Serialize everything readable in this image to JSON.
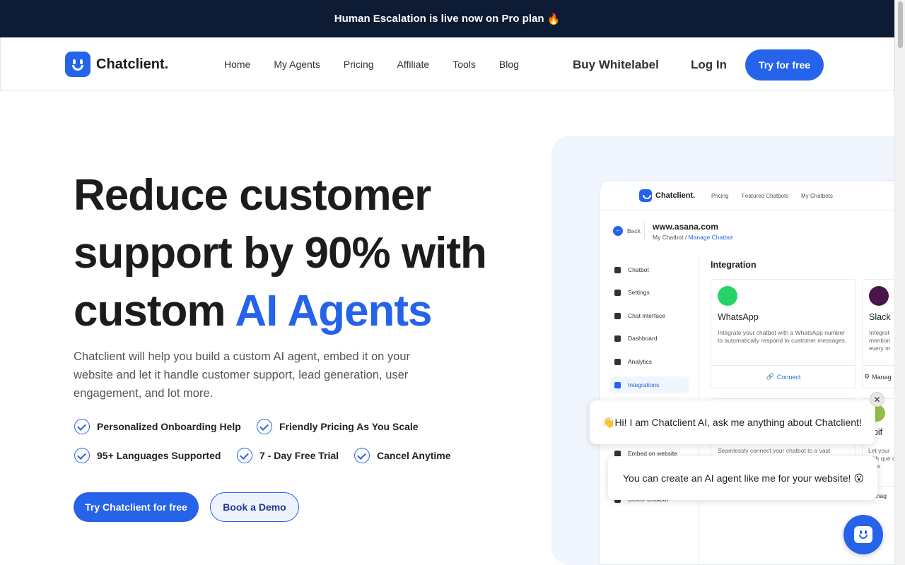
{
  "banner": {
    "text": "Human Escalation is live now on Pro plan",
    "emoji": "🔥"
  },
  "nav": {
    "brand": "Chatclient.",
    "links": [
      "Home",
      "My Agents",
      "Pricing",
      "Affiliate",
      "Tools",
      "Blog"
    ],
    "buy_whitelabel": "Buy Whitelabel",
    "login": "Log In",
    "try_free": "Try for free"
  },
  "hero": {
    "title_line1": "Reduce customer",
    "title_line2": "support by 90% with",
    "title_line3_plain": "custom ",
    "title_line3_highlight": "AI Agents",
    "description": "Chatclient will help you build a custom AI agent, embed it on your website and let it handle customer support, lead generation, user engagement, and lot more.",
    "features": [
      "Personalized Onboarding Help",
      "Friendly Pricing As You Scale",
      "95+ Languages Supported",
      "7 - Day Free Trial",
      "Cancel Anytime"
    ],
    "cta_primary": "Try Chatclient for free",
    "cta_secondary": "Book a Demo"
  },
  "mockup": {
    "brand": "Chatclient.",
    "nav": [
      "Pricing",
      "Featured Chatbots",
      "My Chatbots"
    ],
    "back": "Back",
    "site": "www.asana.com",
    "crumb_prefix": "My Chatbot /",
    "crumb_link": "Manage Chatbot",
    "sidebar": [
      "Chatbot",
      "Settings",
      "Chat interface",
      "Dashboard",
      "Analytics",
      "Integrations",
      "Embed on website",
      "Delete Chatbot"
    ],
    "section_title": "Integration",
    "cards": [
      {
        "name": "WhatsApp",
        "desc": "Integrate your chatbot with a WhatsApp number to automatically respond to customer messages.",
        "action": "Connect"
      },
      {
        "name": "Slack",
        "desc": "Integrat mention every m",
        "action": "Manag"
      }
    ],
    "lower_desc_1": "Seamlessly connect your chatbot to a vast",
    "lower_desc_2": "Let your with que d orde",
    "lower_name_2": "opif",
    "lower_action_2": "Manag"
  },
  "chat": {
    "greeting_emoji": "👋",
    "greeting": "Hi! I am Chatclient AI, ask me anything about Chatclient!",
    "pitch": "You can create an AI agent like me for your website!",
    "pitch_emoji": "😮",
    "close": "✕"
  },
  "colors": {
    "accent": "#2563eb",
    "banner": "#0d1b35",
    "whatsapp": "#25d366"
  }
}
